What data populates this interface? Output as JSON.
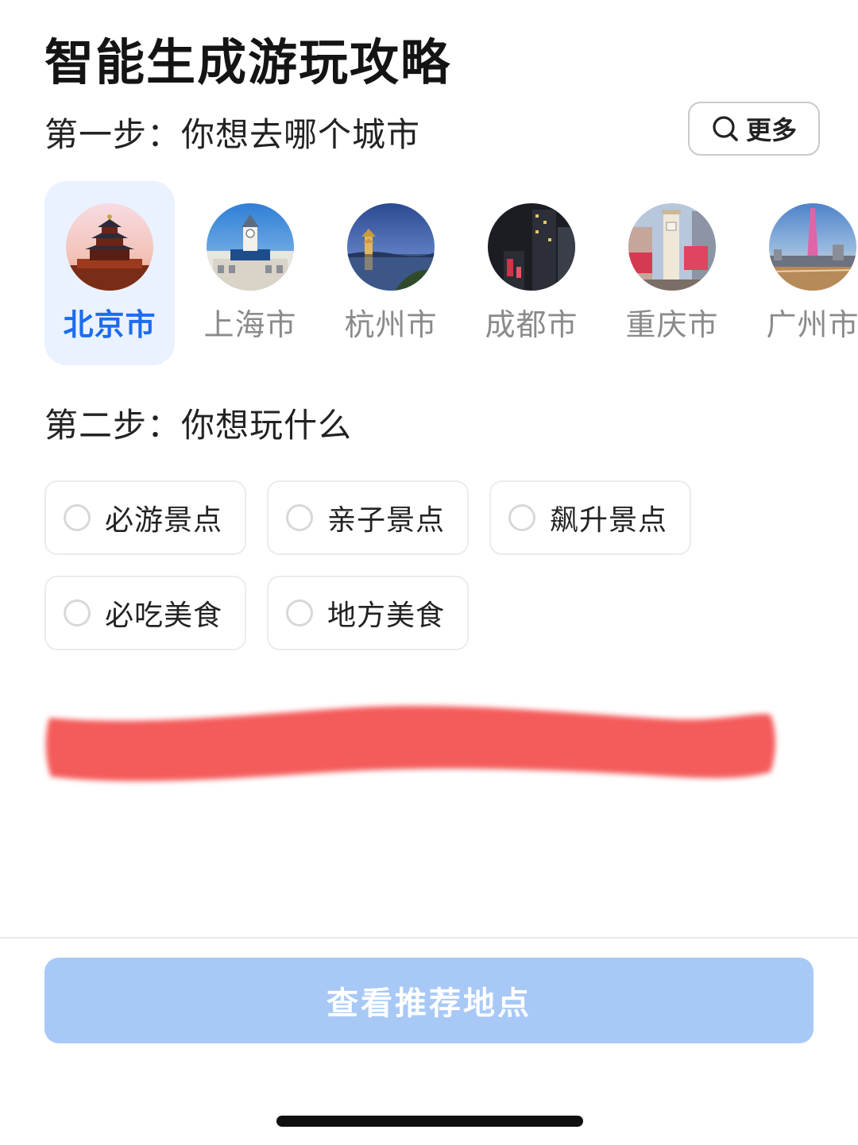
{
  "header": {
    "title": "智能生成游玩攻略"
  },
  "step1": {
    "label": "第一步：你想去哪个城市",
    "more_button": "更多",
    "cities": [
      {
        "name": "北京市",
        "selected": true,
        "image": "temple-of-heaven"
      },
      {
        "name": "上海市",
        "selected": false,
        "image": "clock-tower-building"
      },
      {
        "name": "杭州市",
        "selected": false,
        "image": "lake-pagoda-dusk"
      },
      {
        "name": "成都市",
        "selected": false,
        "image": "night-skyscrapers"
      },
      {
        "name": "重庆市",
        "selected": false,
        "image": "jiefangbei-monument"
      },
      {
        "name": "广州市",
        "selected": false,
        "image": "canton-tower"
      }
    ]
  },
  "step2": {
    "label": "第二步：你想玩什么",
    "options": [
      {
        "label": "必游景点",
        "checked": false
      },
      {
        "label": "亲子景点",
        "checked": false
      },
      {
        "label": "飙升景点",
        "checked": false
      },
      {
        "label": "必吃美食",
        "checked": false
      },
      {
        "label": "地方美食",
        "checked": false
      }
    ]
  },
  "footer": {
    "submit_button": "查看推荐地点"
  },
  "colors": {
    "accent": "#1c6cf0",
    "selected_bg": "#eaf2ff",
    "button_disabled": "#a8c9f6",
    "scribble": "#f45b5b"
  }
}
